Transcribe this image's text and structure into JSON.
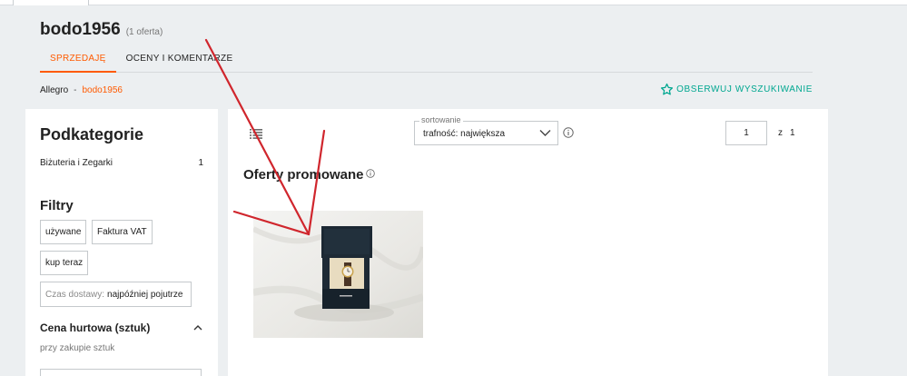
{
  "seller": {
    "name": "bodo1956",
    "offer_count": "(1 oferta)"
  },
  "tabs": [
    {
      "label": "SPRZEDAJĘ",
      "active": true
    },
    {
      "label": "OCENY I KOMENTARZE",
      "active": false
    }
  ],
  "breadcrumb": {
    "home": "Allegro",
    "separator": "-",
    "current": "bodo1956"
  },
  "watch_search": {
    "label": "OBSERWUJ WYSZUKIWANIE",
    "icon": "star-outline-icon",
    "color": "#00a790"
  },
  "sidebar": {
    "title": "Podkategorie",
    "categories": [
      {
        "label": "Biżuteria i Zegarki",
        "count": "1"
      }
    ],
    "filters_title": "Filtry",
    "chips": {
      "used": "używane",
      "vat": "Faktura VAT",
      "buy_now": "kup teraz"
    },
    "delivery": {
      "label": "Czas dostawy:",
      "value": "najpóźniej pojutrze"
    },
    "price": {
      "heading": "Cena hurtowa (sztuk)",
      "subtext": "przy zakupie sztuk"
    }
  },
  "main": {
    "sort": {
      "label": "sortowanie",
      "value": "trafność: największa"
    },
    "pagination": {
      "current": "1",
      "of_label": "z",
      "total": "1"
    },
    "promo_title": "Oferty promowane",
    "product": {
      "image": "watch-in-box-photo"
    }
  },
  "colors": {
    "accent": "#ff5a00",
    "teal": "#00a790",
    "annotation": "#d0262d"
  }
}
